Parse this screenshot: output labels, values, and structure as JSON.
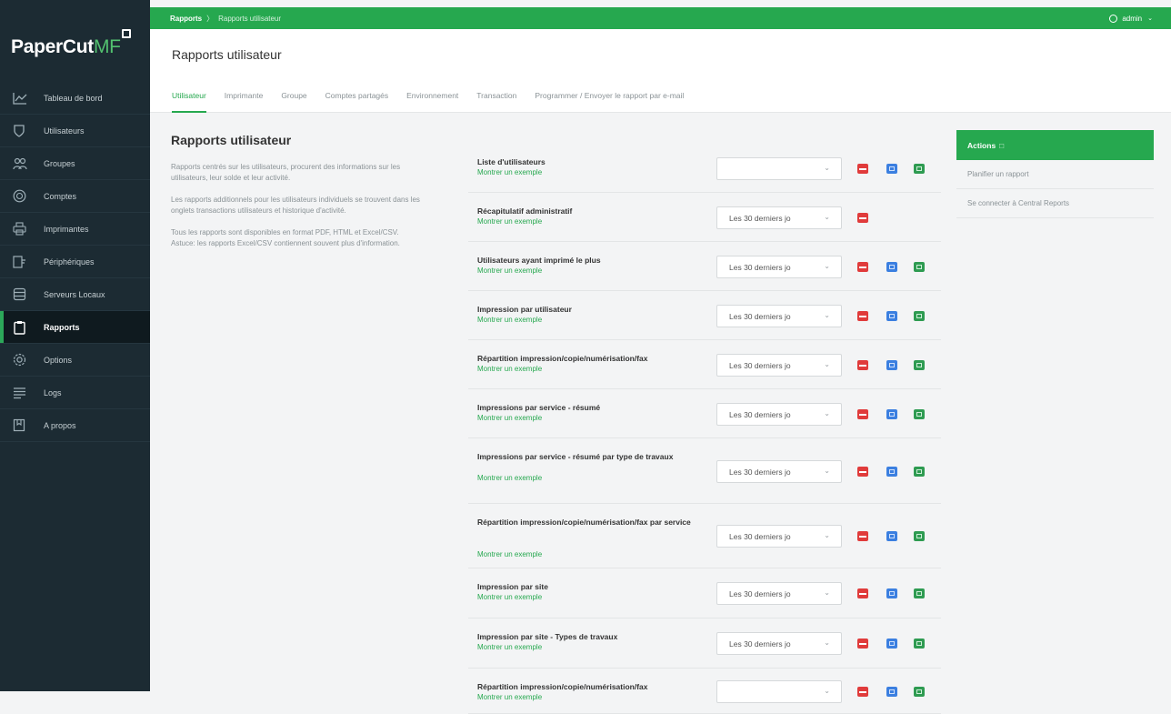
{
  "app": {
    "logo_main": "PaperCut",
    "logo_accent": "MF"
  },
  "breadcrumb": {
    "root": "Rapports",
    "current": "Rapports utilisateur"
  },
  "user": {
    "name": "admin"
  },
  "page": {
    "title": "Rapports utilisateur"
  },
  "sidebar": {
    "items": [
      {
        "label": "Tableau de bord",
        "icon": "chart-icon"
      },
      {
        "label": "Utilisateurs",
        "icon": "shield-icon"
      },
      {
        "label": "Groupes",
        "icon": "group-icon"
      },
      {
        "label": "Comptes",
        "icon": "money-icon"
      },
      {
        "label": "Imprimantes",
        "icon": "printer-icon"
      },
      {
        "label": "Périphériques",
        "icon": "device-icon"
      },
      {
        "label": "Serveurs Locaux",
        "icon": "server-icon"
      },
      {
        "label": "Rapports",
        "icon": "clipboard-icon",
        "active": true
      },
      {
        "label": "Options",
        "icon": "gear-icon"
      },
      {
        "label": "Logs",
        "icon": "list-icon"
      },
      {
        "label": "A propos",
        "icon": "book-icon"
      }
    ]
  },
  "tabs": [
    {
      "label": "Utilisateur",
      "active": true
    },
    {
      "label": "Imprimante"
    },
    {
      "label": "Groupe"
    },
    {
      "label": "Comptes partagés"
    },
    {
      "label": "Environnement"
    },
    {
      "label": "Transaction"
    },
    {
      "label": "Programmer / Envoyer le rapport par e-mail"
    }
  ],
  "section": {
    "title": "Rapports utilisateur",
    "paragraphs": [
      "Rapports centrés sur les utilisateurs, procurent des informations sur les utilisateurs, leur solde et leur activité.",
      "Les rapports additionnels pour les utilisateurs individuels se trouvent dans les onglets transactions utilisateurs et historique d'activité.",
      "Tous les rapports sont disponibles en format PDF, HTML et Excel/CSV. Astuce: les rapports Excel/CSV contiennent souvent plus d'information."
    ]
  },
  "reports": {
    "link_label": "Montrer un exemple",
    "rows": [
      {
        "name": "Liste d'utilisateurs",
        "select": "",
        "pdf": true,
        "html": true,
        "csv": true
      },
      {
        "name": "Récapitulatif administratif",
        "select": "Les 30 derniers jo",
        "pdf": true,
        "html": false,
        "csv": false
      },
      {
        "name": "Utilisateurs ayant imprimé le plus",
        "select": "Les 30 derniers jo",
        "pdf": true,
        "html": true,
        "csv": true
      },
      {
        "name": "Impression par utilisateur",
        "select": "Les 30 derniers jo",
        "pdf": true,
        "html": true,
        "csv": true
      },
      {
        "name": "Répartition impression/copie/numérisation/fax",
        "select": "Les 30 derniers jo",
        "pdf": true,
        "html": true,
        "csv": true
      },
      {
        "name": "Impressions par service - résumé",
        "select": "Les 30 derniers jo",
        "pdf": true,
        "html": true,
        "csv": true
      },
      {
        "name": "Impressions par service - résumé par type de travaux",
        "select": "Les 30 derniers jo",
        "pdf": true,
        "html": true,
        "csv": true
      },
      {
        "name": "Répartition impression/copie/numérisation/fax par service",
        "select": "Les 30 derniers jo",
        "pdf": true,
        "html": true,
        "csv": true
      },
      {
        "name": "Impression par site",
        "select": "Les 30 derniers jo",
        "pdf": true,
        "html": true,
        "csv": true
      },
      {
        "name": "Impression par site - Types de travaux",
        "select": "Les 30 derniers jo",
        "pdf": true,
        "html": true,
        "csv": true
      },
      {
        "name": "Répartition impression/copie/numérisation/fax",
        "select": "",
        "pdf": true,
        "html": true,
        "csv": true
      }
    ]
  },
  "actions": {
    "title": "Actions",
    "items": [
      "Planifier un rapport",
      "Se connecter à Central Reports"
    ]
  },
  "colors": {
    "accent": "#26a84f",
    "sidebar": "#1c2b33",
    "pdf": "#e03b3b",
    "html": "#3b7fe0",
    "csv": "#2e9b51"
  }
}
